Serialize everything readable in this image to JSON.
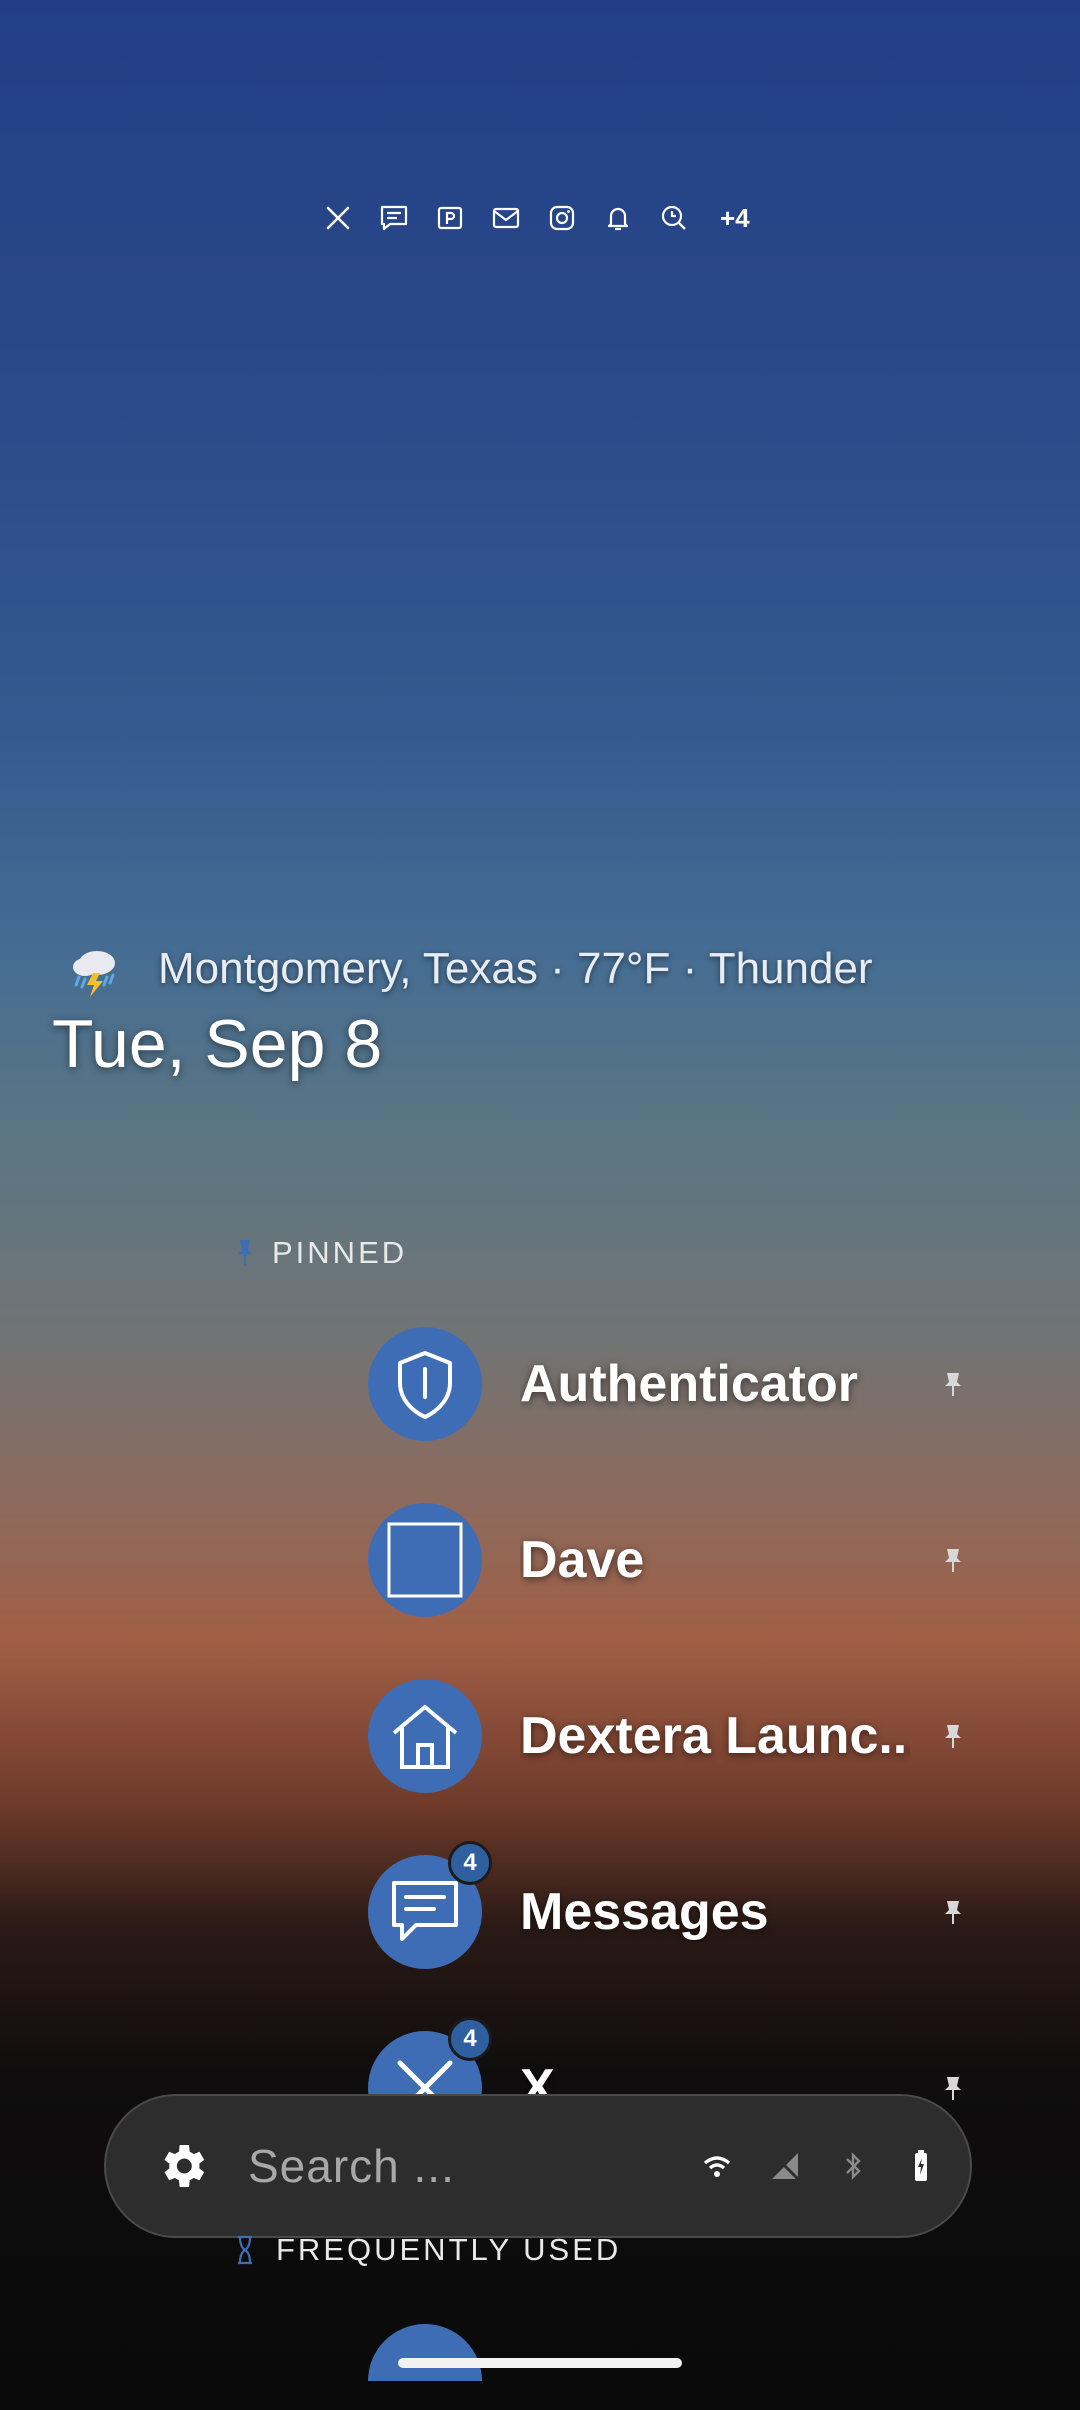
{
  "notifications": {
    "icons": [
      "x-icon",
      "message-icon",
      "parking-icon",
      "mail-icon",
      "instagram-icon",
      "bell-icon",
      "clock-search-icon"
    ],
    "more_label": "+4"
  },
  "weather": {
    "text": "Montgomery, Texas · 77°F · Thunder",
    "icon": "thunderstorm-icon"
  },
  "date": "Tue, Sep 8",
  "pinned": {
    "label": "PINNED",
    "apps": [
      {
        "name": "Authenticator",
        "icon": "shield-icon",
        "badge": ""
      },
      {
        "name": "Dave",
        "icon": "square-icon",
        "badge": ""
      },
      {
        "name": "Dextera Launc...",
        "icon": "home-icon",
        "badge": ""
      },
      {
        "name": "Messages",
        "icon": "chat-icon",
        "badge": "4"
      },
      {
        "name": "X",
        "icon": "x-icon",
        "badge": "4"
      }
    ]
  },
  "search": {
    "placeholder": "Search ..."
  },
  "frequently_used": {
    "label": "FREQUENTLY USED"
  },
  "colors": {
    "accent": "#3f6db5",
    "search_bg": "#2d2d2e"
  }
}
